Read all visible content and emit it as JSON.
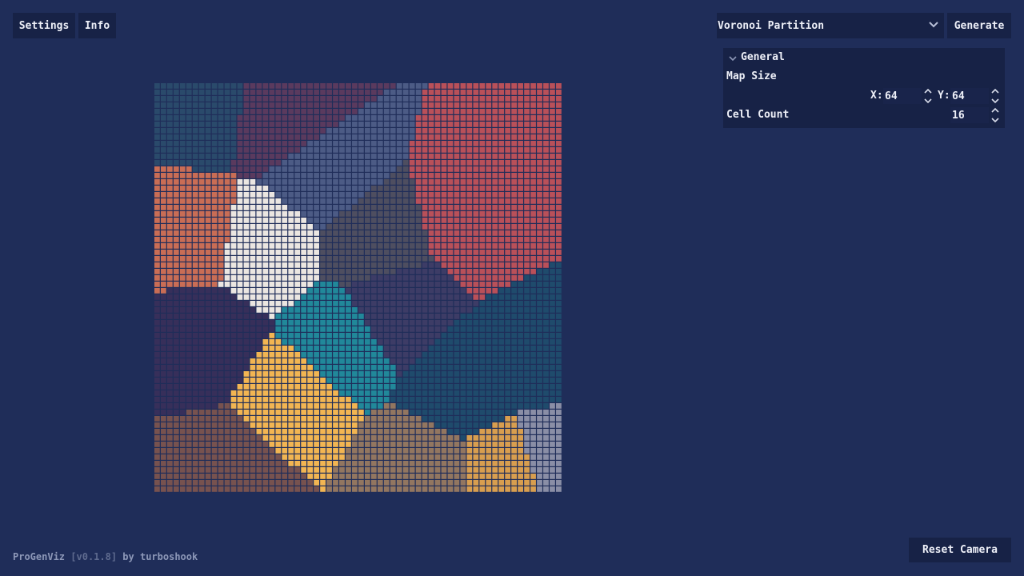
{
  "toolbar": {
    "settings_label": "Settings",
    "info_label": "Info",
    "generate_label": "Generate",
    "reset_camera_label": "Reset Camera"
  },
  "algorithm_select": {
    "selected": "Voronoi Partition",
    "icon": "chevron-down-icon"
  },
  "panel": {
    "section_title": "General",
    "section_icon": "chevron-down-icon",
    "map_size_label": "Map Size",
    "x_label": "X:",
    "x_value": "64",
    "y_label": "Y:",
    "y_value": "64",
    "cell_count_label": "Cell Count",
    "cell_count_value": "16",
    "stepper_icon": "up-down-arrows-icon"
  },
  "footer": {
    "app_name": "ProGenViz",
    "version": "[v0.1.8]",
    "by": "by turboshook"
  },
  "map": {
    "grid_width": 64,
    "grid_height": 64,
    "cell_count": 16,
    "background": "#1f2d59",
    "sites": [
      {
        "x": 6,
        "y": 3,
        "color": "#2a4a6b"
      },
      {
        "x": 20,
        "y": 5,
        "color": "#5a3a5e"
      },
      {
        "x": 50,
        "y": 20,
        "color": "#b95059"
      },
      {
        "x": 26,
        "y": 14,
        "color": "#4c5b85"
      },
      {
        "x": 5,
        "y": 23,
        "color": "#c96d55"
      },
      {
        "x": 34,
        "y": 24,
        "color": "#4e4e60"
      },
      {
        "x": 17,
        "y": 25,
        "color": "#ebe6e1"
      },
      {
        "x": 7,
        "y": 40,
        "color": "#372f5a"
      },
      {
        "x": 37,
        "y": 35,
        "color": "#3d3c66"
      },
      {
        "x": 29,
        "y": 40,
        "color": "#21889a"
      },
      {
        "x": 48,
        "y": 47,
        "color": "#1f4b6c"
      },
      {
        "x": 61,
        "y": 42,
        "color": "#1f4b6c"
      },
      {
        "x": 21,
        "y": 49,
        "color": "#f2b552"
      },
      {
        "x": 11,
        "y": 60,
        "color": "#77524f"
      },
      {
        "x": 41,
        "y": 60,
        "color": "#927660"
      },
      {
        "x": 55,
        "y": 60,
        "color": "#d89e4f"
      },
      {
        "x": 62,
        "y": 58,
        "color": "#8a8ea6"
      }
    ]
  }
}
